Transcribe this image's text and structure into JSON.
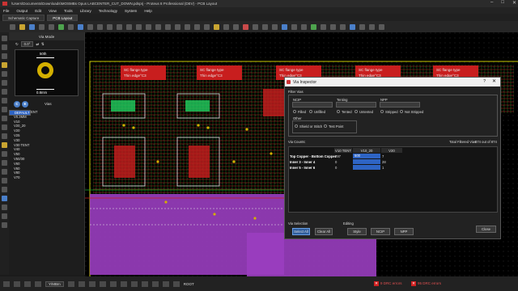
{
  "titlebar": {
    "title": "\\Users\\Documents\\Downloads\\MOSMBs Opus LABCENTER_CUT_DOWN.pdsprj - Proteus 8 Professional (DEV) - PCB Layout"
  },
  "menu": [
    "File",
    "Output",
    "Edit",
    "View",
    "Tools",
    "Library",
    "Technology",
    "System",
    "Help"
  ],
  "tabs": [
    {
      "label": "Schematic Capture"
    },
    {
      "label": "PCB Layout"
    }
  ],
  "side": {
    "mode_title": "Via Mode",
    "rotation": "0.0°",
    "dim_top": "50th",
    "dim_bottom": "0.8mm",
    "btn_c": "C",
    "btn_e": "E",
    "vias_label": "Vias",
    "via_list": [
      "DEFAULT",
      "DEFAULTTENT",
      "V0.3MM",
      "V10",
      "V20_20",
      "V20",
      "V25",
      "V30",
      "V30 TENT",
      "V40",
      "V50",
      "V50/30",
      "V60",
      "V60",
      "V80",
      "V70"
    ],
    "selected_index": 0
  },
  "pcb": {
    "colors": {
      "outline": "#c8c800",
      "trace_red": "#c81e1e",
      "trace_green": "#1ea82a",
      "ground_purple": "#9a3ec0",
      "silk": "#e8e8e8",
      "pad_green": "#1fcf5f",
      "via_yellow": "#d4b000"
    },
    "footprint_labels": [
      "SC flange type",
      "Thin edge°C3"
    ]
  },
  "dialog": {
    "title": "Via Inspector",
    "help": "?",
    "filter_label": "Filter Vias",
    "ncip_label": "NCIP",
    "tenting_label": "Tenting",
    "npp_label": "NPP",
    "radios": [
      {
        "label": "Filled"
      },
      {
        "label": "Unfilled"
      },
      {
        "label": "Tented"
      },
      {
        "label": "Untented"
      },
      {
        "label": "Stripped"
      },
      {
        "label": "Not Stripped"
      }
    ],
    "other_label": "Other",
    "other_radios": [
      {
        "label": "Shield or Stitch"
      },
      {
        "label": "Test Point"
      }
    ],
    "via_counts_label": "Via Counts:",
    "total_label": "Total Filtered Vias:",
    "total_value": "874 out of 874",
    "columns": [
      "V10 TENT",
      "V10_20",
      "V20"
    ],
    "rows": [
      {
        "label": "Top Copper - Bottom Copper",
        "values": [
          "297",
          "500",
          "7"
        ]
      },
      {
        "label": "Inner 3 - Inner 4",
        "values": [
          "0",
          "",
          "28"
        ]
      },
      {
        "label": "Inner 5 - Inner 6",
        "values": [
          "0",
          "",
          "1"
        ]
      }
    ],
    "via_selection_label": "Via Selection",
    "editing_label": "Editing",
    "select_all": "Select All",
    "clear_all": "Clear All",
    "style": "Style",
    "ncip": "NCIP",
    "npp": "NPP",
    "close": "Close"
  },
  "status": {
    "zoom": "Y/MBm",
    "layer": "ROOT",
    "errors": [
      "9 DRC errors",
      "95 DRC errors"
    ]
  }
}
